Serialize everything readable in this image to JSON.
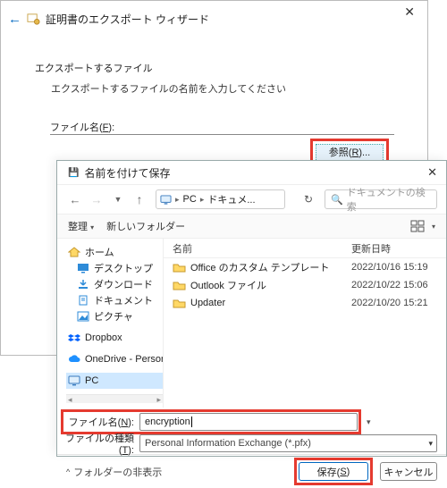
{
  "wizard": {
    "title": "証明書のエクスポート ウィザード",
    "section": "エクスポートするファイル",
    "instruction": "エクスポートするファイルの名前を入力してください",
    "filename_label_pre": "ファイル名(",
    "filename_label_u": "F",
    "filename_label_post": "):",
    "browse_label_pre": "参照(",
    "browse_label_u": "R",
    "browse_label_post": ")..."
  },
  "dialog": {
    "title": "名前を付けて保存",
    "breadcrumbs": {
      "seg1": "PC",
      "seg2": "ドキュメ..."
    },
    "search_placeholder": "ドキュメントの検索",
    "organize": "整理",
    "new_folder": "新しいフォルダー",
    "columns": {
      "name": "名前",
      "date": "更新日時"
    },
    "tree": {
      "home": "ホーム",
      "desktop": "デスクトップ",
      "downloads": "ダウンロード",
      "documents": "ドキュメント",
      "pictures": "ピクチャ",
      "dropbox": "Dropbox",
      "onedrive": "OneDrive - Person",
      "pc": "PC"
    },
    "files": [
      {
        "name": "Office のカスタム テンプレート",
        "date": "2022/10/16 15:19"
      },
      {
        "name": "Outlook ファイル",
        "date": "2022/10/22 15:06"
      },
      {
        "name": "Updater",
        "date": "2022/10/20 15:21"
      }
    ],
    "filename_label_pre": "ファイル名(",
    "filename_label_u": "N",
    "filename_label_post": "):",
    "filename_value": "encryption",
    "filetype_label_pre": "ファイルの種類(",
    "filetype_label_u": "T",
    "filetype_label_post": "):",
    "filetype_value": "Personal Information Exchange (*.pfx)",
    "folder_hide": "フォルダーの非表示",
    "save_pre": "保存(",
    "save_u": "S",
    "save_post": ")",
    "cancel": "キャンセル"
  },
  "colors": {
    "highlight": "#e53a2f",
    "accent": "#0067c0"
  }
}
